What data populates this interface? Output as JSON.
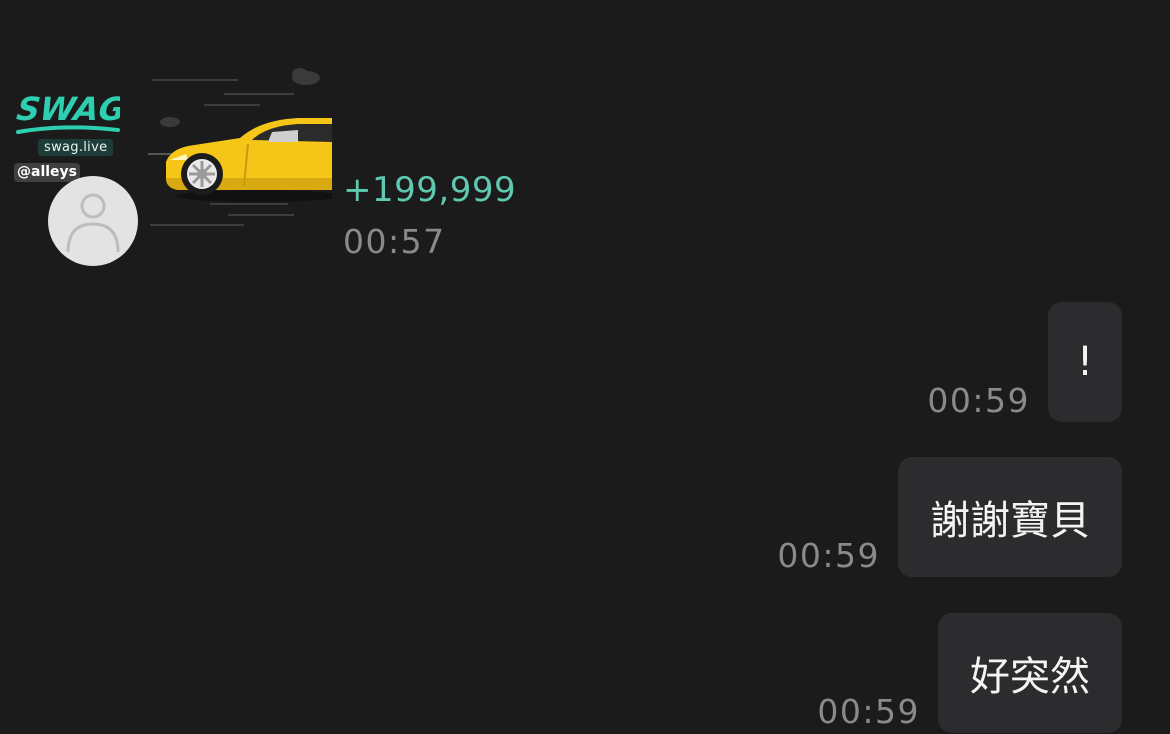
{
  "watermark": {
    "logo_text": "SWAG",
    "site": "swag.live",
    "handle": "@alleys"
  },
  "incoming": {
    "gift": {
      "amount": "+199,999",
      "time": "00:57",
      "image_icon": "yellow-sports-car-icon"
    }
  },
  "outgoing": [
    {
      "text": "!",
      "time": "00:59"
    },
    {
      "text": "謝謝寶貝",
      "time": "00:59"
    },
    {
      "text": "好突然",
      "time": "00:59"
    }
  ],
  "colors": {
    "background": "#1b1b1c",
    "bubble": "#2c2c2e",
    "accent_teal": "#5ec9b0",
    "timestamp": "#8a8a8a",
    "car_yellow": "#f5c518"
  }
}
